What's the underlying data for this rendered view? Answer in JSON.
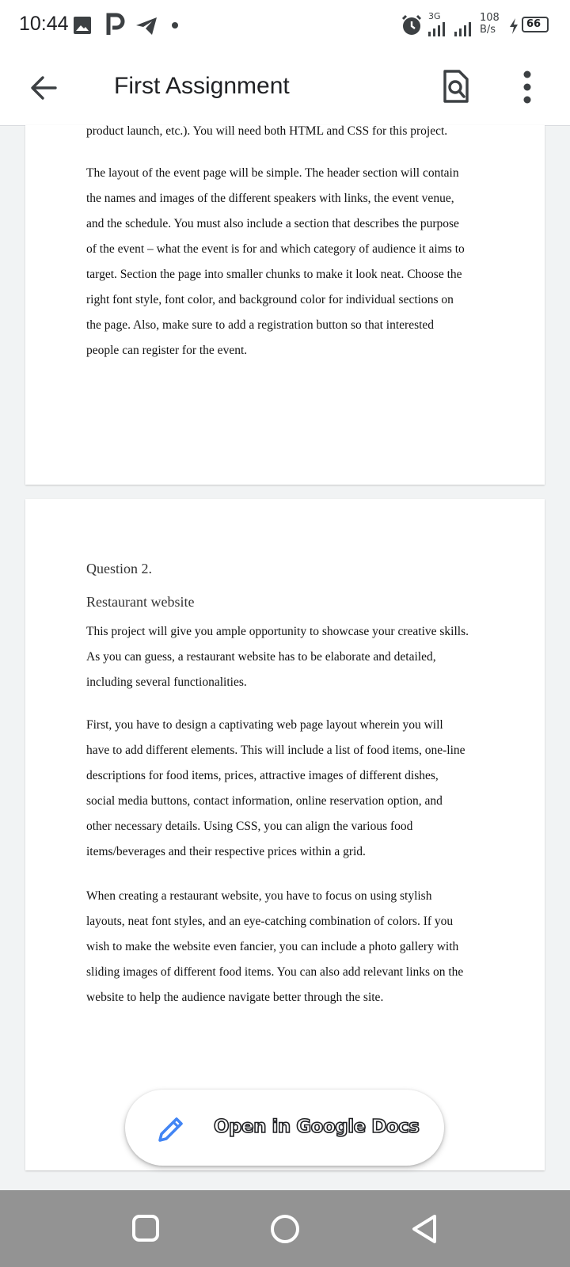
{
  "status_bar": {
    "time": "10:44",
    "network_label": "3G",
    "speed_value": "108",
    "speed_unit": "B/s",
    "battery": "66",
    "icons": [
      "gallery-icon",
      "p-app-icon",
      "telegram-icon",
      "dot-icon",
      "alarm-icon",
      "signal-icon",
      "signal-icon-2",
      "charging-icon",
      "battery-icon"
    ]
  },
  "app_bar": {
    "title": "First Assignment",
    "icons": [
      "back-arrow-icon",
      "find-in-page-icon",
      "more-vert-icon"
    ]
  },
  "document": {
    "page1": {
      "lines_a": [
        "product launch, etc.). You will need both HTML and CSS for this project."
      ],
      "lines_b": [
        "The layout of the event page will be simple. The header section will contain",
        "the names and images of the different speakers with links, the event venue,",
        "and the schedule. You must also include a section that describes the purpose",
        "of the event – what the event is for and which category of audience it aims to",
        "target. Section the page into smaller chunks to make it look neat. Choose the",
        "right font style, font color, and background color for individual sections on",
        "the page. Also, make sure to add a registration button so that interested",
        "people can register for the event."
      ]
    },
    "page2": {
      "question": "Question 2.",
      "heading": "Restaurant website",
      "para1": [
        "This project will give you ample opportunity to showcase your creative skills.",
        "As you can guess, a restaurant website has to be elaborate and detailed,",
        "including several functionalities."
      ],
      "para2": [
        "First, you have to design a captivating web page layout wherein you will",
        "have to add different elements. This will include a list of food items, one-line",
        "descriptions for food items, prices, attractive images of different dishes,",
        "social media buttons, contact information, online reservation option, and",
        "other necessary details. Using CSS, you can align the various food",
        "items/beverages and their respective prices within a grid."
      ],
      "para3": [
        "When creating a restaurant website, you have to focus on using stylish",
        "layouts, neat font styles, and an eye-catching combination of colors. If you",
        "wish to make the website even fancier, you can include a photo gallery with",
        "sliding images of different food items. You can also add relevant links on the",
        "website to help the audience navigate better through the site."
      ]
    }
  },
  "fab": {
    "label": "Open in Google Docs",
    "icon": "pencil-icon",
    "icon_color": "#4285f4"
  },
  "nav_bar": {
    "icons": [
      "recents-square-icon",
      "home-circle-icon",
      "back-triangle-icon"
    ],
    "color": "#939393"
  }
}
